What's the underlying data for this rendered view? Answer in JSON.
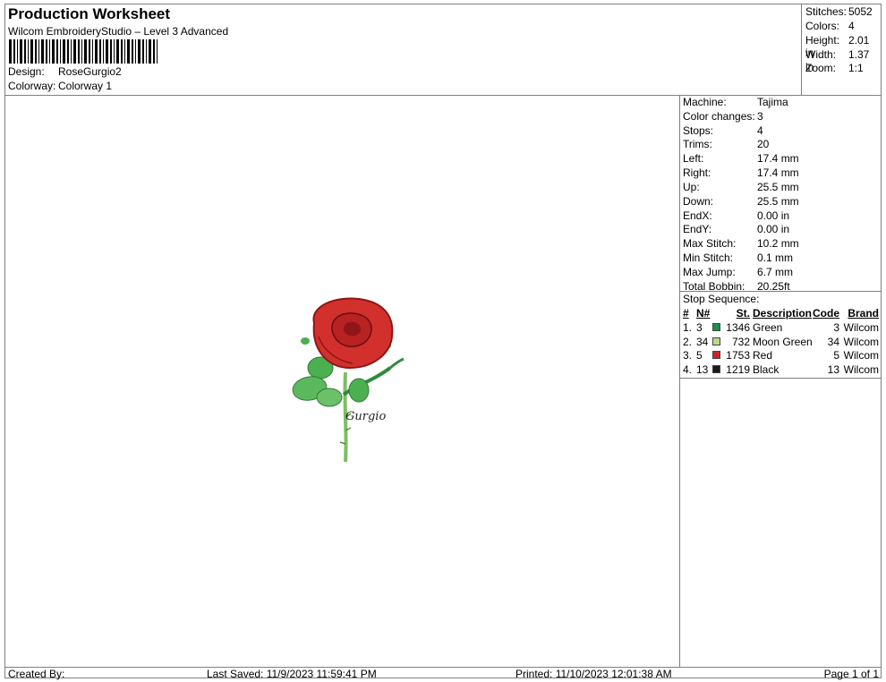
{
  "header": {
    "title": "Production Worksheet",
    "software": "Wilcom EmbroideryStudio – Level 3 Advanced",
    "design_label": "Design:",
    "design_value": "RoseGurgio2",
    "colorway_label": "Colorway:",
    "colorway_value": "Colorway 1"
  },
  "summary": [
    {
      "label": "Stitches:",
      "value": "5052"
    },
    {
      "label": "Colors:",
      "value": "4"
    },
    {
      "label": "Height:",
      "value": "2.01 in"
    },
    {
      "label": "Width:",
      "value": "1.37 in"
    },
    {
      "label": "Zoom:",
      "value": "1:1"
    }
  ],
  "machine_info": [
    {
      "label": "Machine:",
      "value": "Tajima"
    },
    {
      "label": "Color changes:",
      "value": "3"
    },
    {
      "label": "Stops:",
      "value": "4"
    },
    {
      "label": "Trims:",
      "value": "20"
    },
    {
      "label": "Left:",
      "value": "17.4 mm"
    },
    {
      "label": "Right:",
      "value": "17.4 mm"
    },
    {
      "label": "Up:",
      "value": "25.5 mm"
    },
    {
      "label": "Down:",
      "value": "25.5 mm"
    },
    {
      "label": "EndX:",
      "value": "0.00 in"
    },
    {
      "label": "EndY:",
      "value": "0.00 in"
    },
    {
      "label": "Max Stitch:",
      "value": "10.2 mm"
    },
    {
      "label": "Min Stitch:",
      "value": "0.1 mm"
    },
    {
      "label": "Max Jump:",
      "value": "6.7 mm"
    },
    {
      "label": "Total Bobbin:",
      "value": "20.25ft"
    }
  ],
  "stop_sequence": {
    "title": "Stop Sequence:",
    "headers": {
      "num": "#",
      "n": "N#",
      "st": "St.",
      "description": "Description",
      "code": "Code",
      "brand": "Brand"
    },
    "rows": [
      {
        "num": "1.",
        "n": "3",
        "color": "#1f8f4a",
        "st": "1346",
        "description": "Green",
        "code": "3",
        "brand": "Wilcom"
      },
      {
        "num": "2.",
        "n": "34",
        "color": "#b9d88a",
        "st": "732",
        "description": "Moon Green",
        "code": "34",
        "brand": "Wilcom"
      },
      {
        "num": "3.",
        "n": "5",
        "color": "#c8262b",
        "st": "1753",
        "description": "Red",
        "code": "5",
        "brand": "Wilcom"
      },
      {
        "num": "4.",
        "n": "13",
        "color": "#1a1a1a",
        "st": "1219",
        "description": "Black",
        "code": "13",
        "brand": "Wilcom"
      }
    ]
  },
  "artwork": {
    "signature": "Gurgio",
    "colors": {
      "rose": "#d2302c",
      "rose_dark": "#8e1616",
      "leaf": "#4caf50",
      "leaf_light": "#a8d58a",
      "stem": "#7bbf5e"
    }
  },
  "footer": {
    "created_by": "Created By:",
    "last_saved": "Last Saved: 11/9/2023 11:59:41 PM",
    "printed": "Printed: 11/10/2023 12:01:38 AM",
    "page": "Page 1 of 1"
  }
}
